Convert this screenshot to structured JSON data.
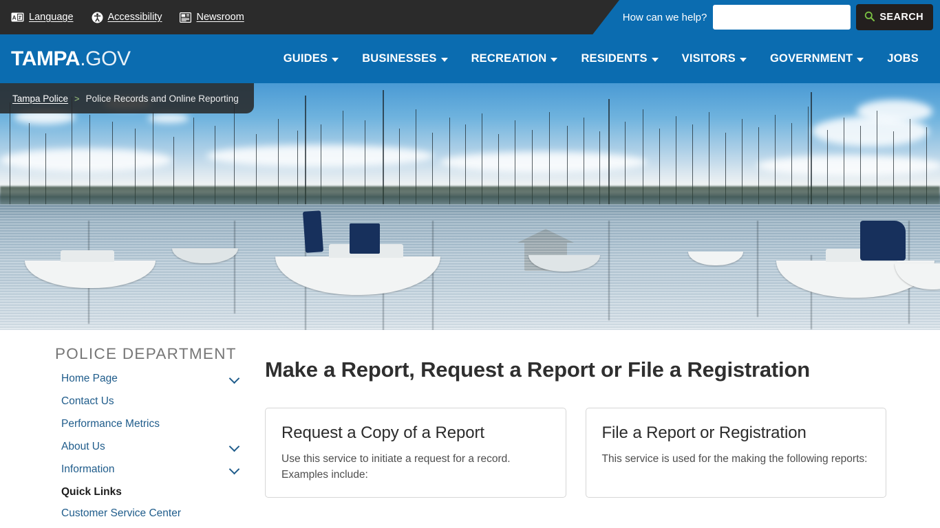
{
  "utility_bar": {
    "links": [
      {
        "label": "Language",
        "icon": "translate-icon"
      },
      {
        "label": "Accessibility",
        "icon": "accessibility-icon"
      },
      {
        "label": "Newsroom",
        "icon": "newspaper-icon"
      }
    ],
    "help_text": "How can we help?",
    "search_placeholder": "",
    "search_value": "",
    "search_button_label": "SEARCH",
    "search_icon": "magnifier-icon",
    "colors": {
      "dark": "#2b2b2b",
      "blue": "#0b6cb0",
      "search_icon": "#7ac143"
    }
  },
  "header": {
    "brand_strong": "TAMPA",
    "brand_light": ".GOV",
    "nav_items": [
      {
        "label": "GUIDES",
        "has_caret": true
      },
      {
        "label": "BUSINESSES",
        "has_caret": true
      },
      {
        "label": "RECREATION",
        "has_caret": true
      },
      {
        "label": "RESIDENTS",
        "has_caret": true
      },
      {
        "label": "VISITORS",
        "has_caret": true
      },
      {
        "label": "GOVERNMENT",
        "has_caret": true
      },
      {
        "label": "JOBS",
        "has_caret": false
      }
    ]
  },
  "breadcrumb": {
    "parent": "Tampa Police",
    "separator": ">",
    "current": "Police Records and Online Reporting"
  },
  "hero": {
    "alt": "Sailboats moored in a Tampa marina under a partly cloudy sky"
  },
  "sidebar": {
    "title": "POLICE DEPARTMENT",
    "items": [
      {
        "label": "Home Page",
        "expandable": true,
        "heading": false
      },
      {
        "label": "Contact Us",
        "expandable": false,
        "heading": false
      },
      {
        "label": "Performance Metrics",
        "expandable": false,
        "heading": false
      },
      {
        "label": "About Us",
        "expandable": true,
        "heading": false
      },
      {
        "label": "Information",
        "expandable": true,
        "heading": false
      },
      {
        "label": "Quick Links",
        "expandable": false,
        "heading": true
      },
      {
        "label": "Customer Service Center",
        "expandable": false,
        "heading": false
      }
    ]
  },
  "main": {
    "page_title": "Make a Report, Request a Report or File a Registration",
    "cards": [
      {
        "title": "Request a Copy of a Report",
        "body": "Use this service to initiate a request for a record. Examples include:"
      },
      {
        "title": "File a Report or Registration",
        "body": "This service is used for the making the following reports:"
      }
    ]
  }
}
